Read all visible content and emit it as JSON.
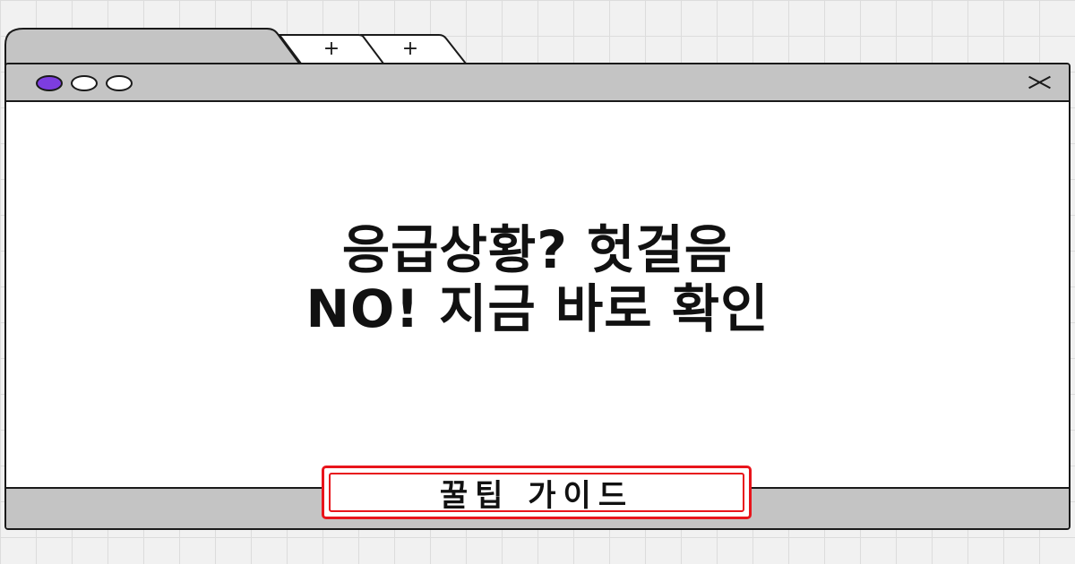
{
  "tabs": [
    {
      "id": "active",
      "label": ""
    },
    {
      "id": "new1",
      "icon": "plus-icon",
      "label": "+"
    },
    {
      "id": "new2",
      "icon": "plus-icon",
      "label": "+"
    }
  ],
  "window_controls": {
    "dots": [
      {
        "name": "purple",
        "color": "#7d3de0"
      },
      {
        "name": "white",
        "color": "#ffffff"
      },
      {
        "name": "white",
        "color": "#ffffff"
      }
    ],
    "close_icon": "close-icon"
  },
  "headline": {
    "line1": "응급상황? 헛걸음",
    "line2": "NO! 지금 바로 확인"
  },
  "badge": {
    "label": "꿀팁 가이드",
    "color": "#e8141b"
  },
  "colors": {
    "chrome": "#c4c4c4",
    "background_grid": "#dcdcdc",
    "accent_dot": "#7d3de0",
    "outline": "#1a1a1a"
  }
}
